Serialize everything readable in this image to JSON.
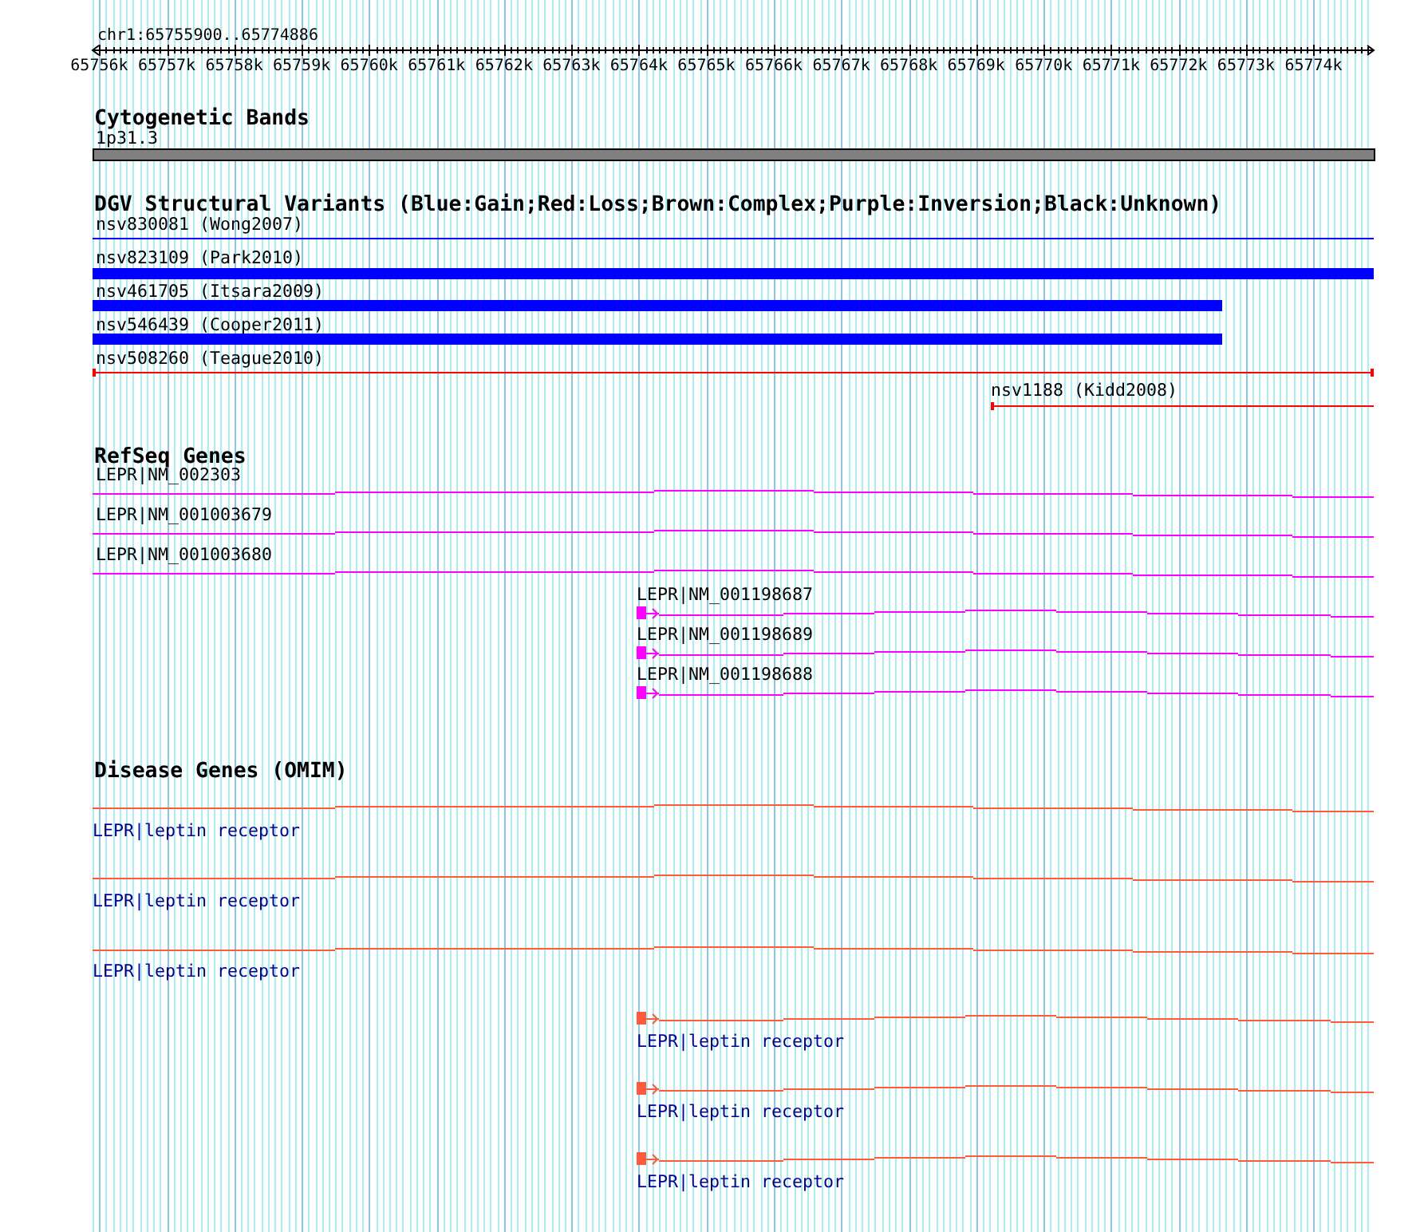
{
  "ruler": {
    "title": "chr1:65755900..65774886",
    "tick_labels": [
      "65756k",
      "65757k",
      "65758k",
      "65759k",
      "65760k",
      "65761k",
      "65762k",
      "65763k",
      "65764k",
      "65765k",
      "65766k",
      "65767k",
      "65768k",
      "65769k",
      "65770k",
      "65771k",
      "65772k",
      "65773k",
      "65774k"
    ]
  },
  "tracks": [
    {
      "kind": "cytoband",
      "title": "Cytogenetic Bands",
      "features": [
        {
          "label": "1p31.3"
        }
      ]
    },
    {
      "kind": "dgv",
      "title": "DGV Structural Variants (Blue:Gain;Red:Loss;Brown:Complex;Purple:Inversion;Black:Unknown)",
      "features": [
        {
          "label": "nsv830081 (Wong2007)",
          "kind": "thin",
          "color": "#0000ff"
        },
        {
          "label": "nsv823109 (Park2010)",
          "kind": "thick",
          "color": "#0000ff"
        },
        {
          "label": "nsv461705 (Itsara2009)",
          "kind": "thick",
          "color": "#0000ff"
        },
        {
          "label": "nsv546439 (Cooper2011)",
          "kind": "thick",
          "color": "#0000ff"
        },
        {
          "label": "nsv508260 (Teague2010)",
          "kind": "thin",
          "color": "#ff0000"
        },
        {
          "label": "nsv1188 (Kidd2008)",
          "kind": "thin",
          "color": "#ff0000"
        }
      ]
    },
    {
      "kind": "refseq",
      "title": "RefSeq Genes",
      "features": [
        {
          "label": "LEPR|NM_002303"
        },
        {
          "label": "LEPR|NM_001003679"
        },
        {
          "label": "LEPR|NM_001003680"
        },
        {
          "label": "LEPR|NM_001198687"
        },
        {
          "label": "LEPR|NM_001198689"
        },
        {
          "label": "LEPR|NM_001198688"
        }
      ]
    },
    {
      "kind": "omim",
      "title": "Disease Genes (OMIM)",
      "features": [
        {
          "label": "LEPR|leptin receptor"
        },
        {
          "label": "LEPR|leptin receptor"
        },
        {
          "label": "LEPR|leptin receptor"
        },
        {
          "label": "LEPR|leptin receptor"
        },
        {
          "label": "LEPR|leptin receptor"
        },
        {
          "label": "LEPR|leptin receptor"
        }
      ]
    }
  ]
}
